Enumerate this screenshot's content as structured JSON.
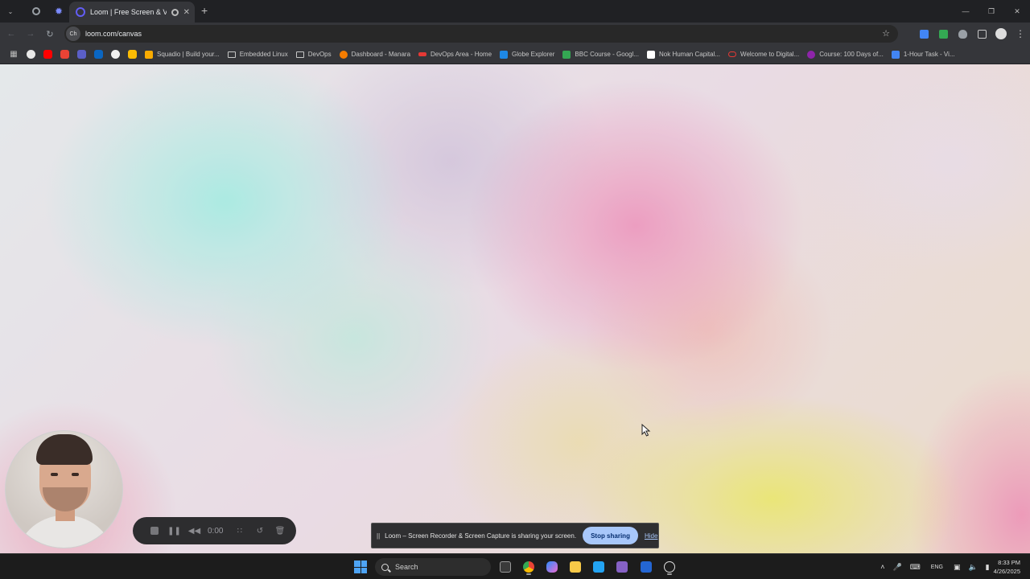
{
  "browser": {
    "tab": {
      "title": "Loom | Free Screen & Video...",
      "new_tab_icon": "plus-icon"
    },
    "address": {
      "url": "loom.com/canvas",
      "site_info_text": "Ch"
    },
    "bookmarks": [
      {
        "label": "Squadio | Build your...",
        "color": "#f9ab00"
      },
      {
        "label": "Embedded Linux",
        "folder": true
      },
      {
        "label": "DevOps",
        "folder": true
      },
      {
        "label": "Dashboard - Manara",
        "color": "#f57c00"
      },
      {
        "label": "DevOps Area - Home",
        "color": "#e53935"
      },
      {
        "label": "Globe Explorer",
        "color": "#1e88e5"
      },
      {
        "label": "BBC Course - Googl...",
        "color": "#34a853"
      },
      {
        "label": "Nok Human Capital...",
        "color": "#ffffff"
      },
      {
        "label": "Welcome to Digital...",
        "color": "#e53935"
      },
      {
        "label": "Course: 100 Days of...",
        "color": "#8e24aa"
      },
      {
        "label": "1-Hour Task - Vi...",
        "color": "#4285f4"
      }
    ],
    "bookmark_icons": [
      "chatgpt-icon",
      "youtube-icon",
      "gmail-icon",
      "teams-icon",
      "linkedin-icon",
      "github-icon",
      "drive-icon"
    ],
    "colors": {
      "chrome_bg": "#202124",
      "toolbar_bg": "#35363a",
      "loom_accent": "#625df5"
    }
  },
  "recorder": {
    "time": "0:00",
    "controls": [
      "stop-icon",
      "pause-icon",
      "rewind-icon",
      "grid-icon",
      "restart-icon",
      "trash-icon"
    ]
  },
  "share_notice": {
    "pause_glyph": "||",
    "text": "Loom – Screen Recorder & Screen Capture is sharing your screen.",
    "stop_label": "Stop sharing",
    "hide_label": "Hide"
  },
  "taskbar": {
    "search_label": "Search",
    "language": "ENG",
    "time": "8:33 PM",
    "date": "4/26/2025"
  }
}
